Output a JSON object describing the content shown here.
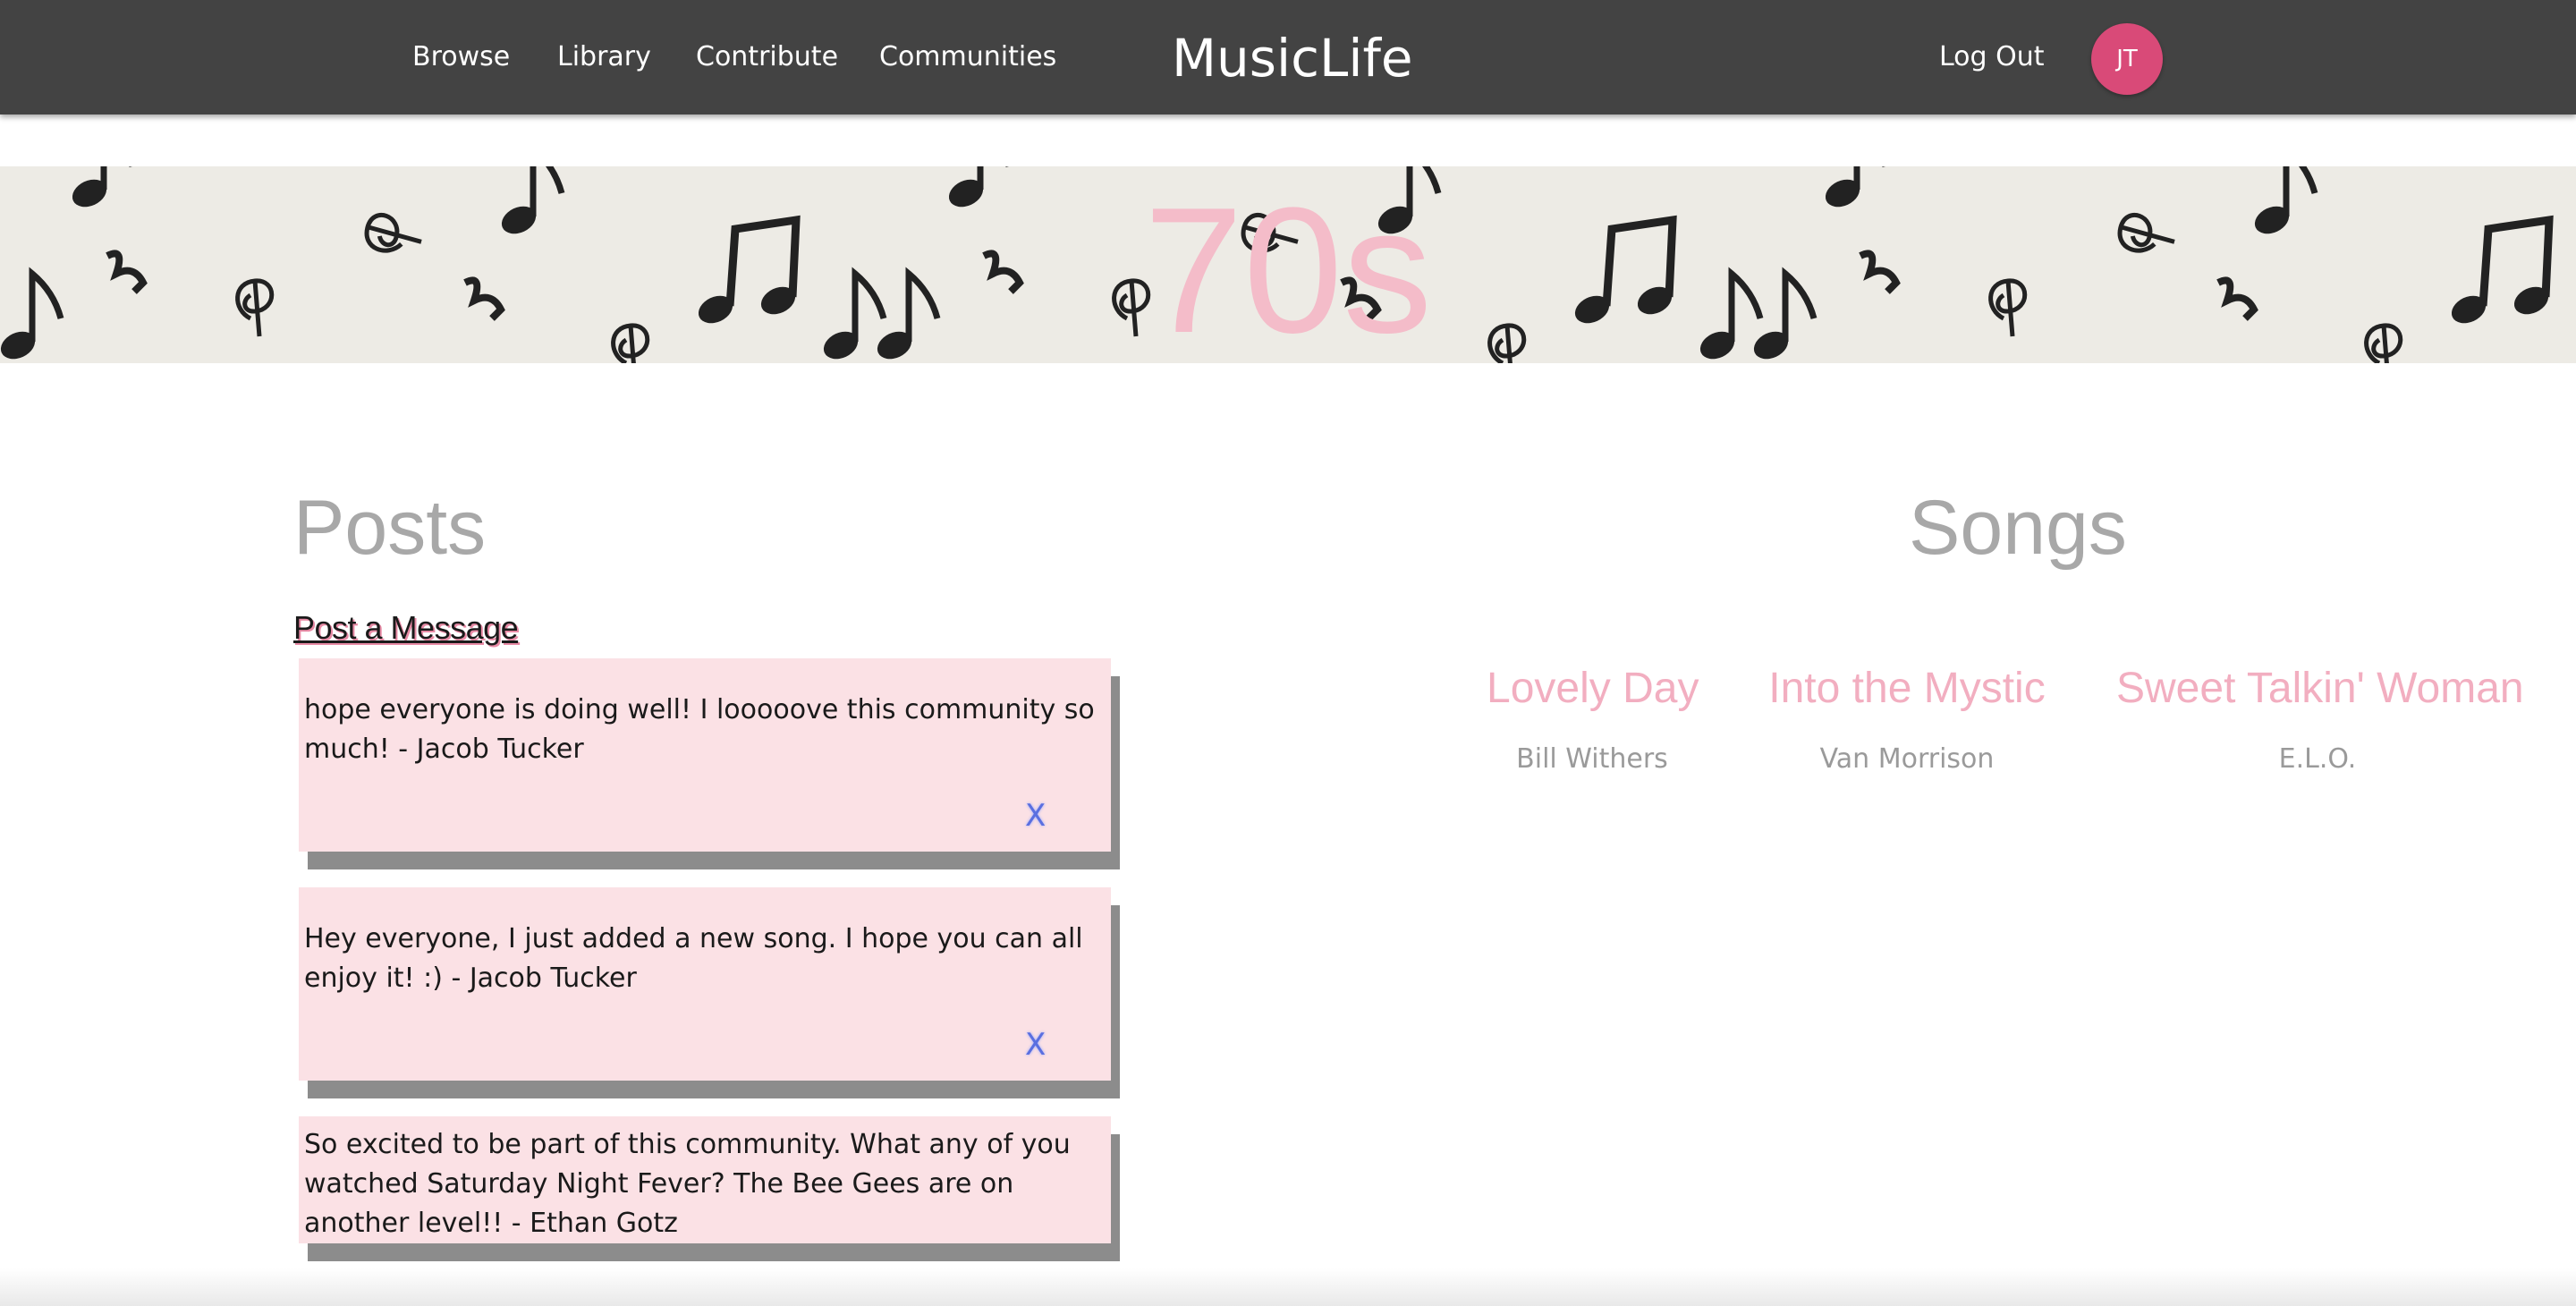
{
  "navbar": {
    "links": [
      "Browse",
      "Library",
      "Contribute",
      "Communities"
    ],
    "brand": "MusicLife",
    "logout_label": "Log Out",
    "avatar_initials": "JT"
  },
  "banner": {
    "title": "70s",
    "pattern_icon": "music-notes-pattern"
  },
  "posts": {
    "heading": "Posts",
    "post_link_label": "Post a Message",
    "items": [
      {
        "text": "hope everyone is doing well! I looooove this community so much! - Jacob Tucker",
        "delete_label": "X"
      },
      {
        "text": "Hey everyone, I just added a new song. I hope you can all enjoy it! :) - Jacob Tucker",
        "delete_label": "X"
      },
      {
        "text": "So excited to be part of this community. What any of you watched Saturday Night Fever? The Bee Gees are on another level!! - Ethan Gotz",
        "delete_label": ""
      }
    ]
  },
  "songs": {
    "heading": "Songs",
    "items": [
      {
        "title": "Lovely Day",
        "artist": "Bill Withers"
      },
      {
        "title": "Into the Mystic",
        "artist": "Van Morrison"
      },
      {
        "title": "Sweet Talkin' Woman",
        "artist": "E.L.O."
      }
    ]
  },
  "colors": {
    "navbar_bg": "#434343",
    "avatar_bg": "#d94a78",
    "accent_pink": "#f2aec0",
    "post_bg": "#fbe1e5",
    "banner_bg": "#edebe5"
  }
}
